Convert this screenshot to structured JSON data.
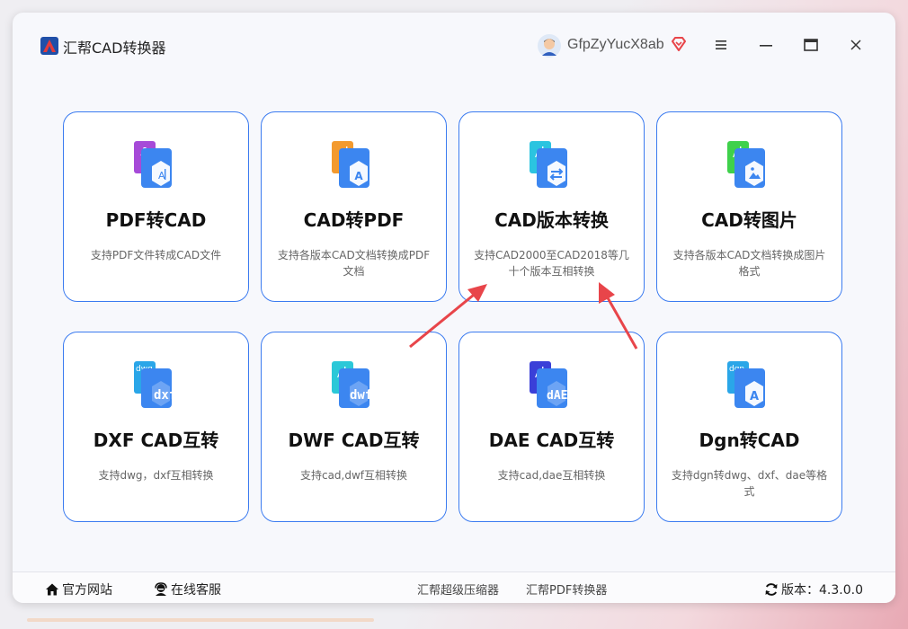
{
  "app": {
    "title": "汇帮CAD转换器"
  },
  "user": {
    "name": "GfpZyYucX8ab"
  },
  "cards": [
    {
      "title": "PDF转CAD",
      "desc": "支持PDF文件转成CAD文件"
    },
    {
      "title": "CAD转PDF",
      "desc": "支持各版本CAD文档转换成PDF文档"
    },
    {
      "title": "CAD版本转换",
      "desc": "支持CAD2000至CAD2018等几十个版本互相转换"
    },
    {
      "title": "CAD转图片",
      "desc": "支持各版本CAD文档转换成图片格式"
    },
    {
      "title": "DXF CAD互转",
      "desc": "支持dwg，dxf互相转换"
    },
    {
      "title": "DWF CAD互转",
      "desc": "支持cad,dwf互相转换"
    },
    {
      "title": "DAE CAD互转",
      "desc": "支持cad,dae互相转换"
    },
    {
      "title": "Dgn转CAD",
      "desc": "支持dgn转dwg、dxf、dae等格式"
    }
  ],
  "icon_labels": {
    "dxf": "dxf",
    "dwf": "dwf",
    "dae": "dAE",
    "dgn": "dgn",
    "dwg": "dwg"
  },
  "footer": {
    "website": "官方网站",
    "service": "在线客服",
    "link1": "汇帮超级压缩器",
    "link2": "汇帮PDF转换器",
    "version": "版本：4.3.0.0"
  },
  "colors": {
    "accent": "#3b7bf0",
    "arrow": "#e8454a"
  }
}
